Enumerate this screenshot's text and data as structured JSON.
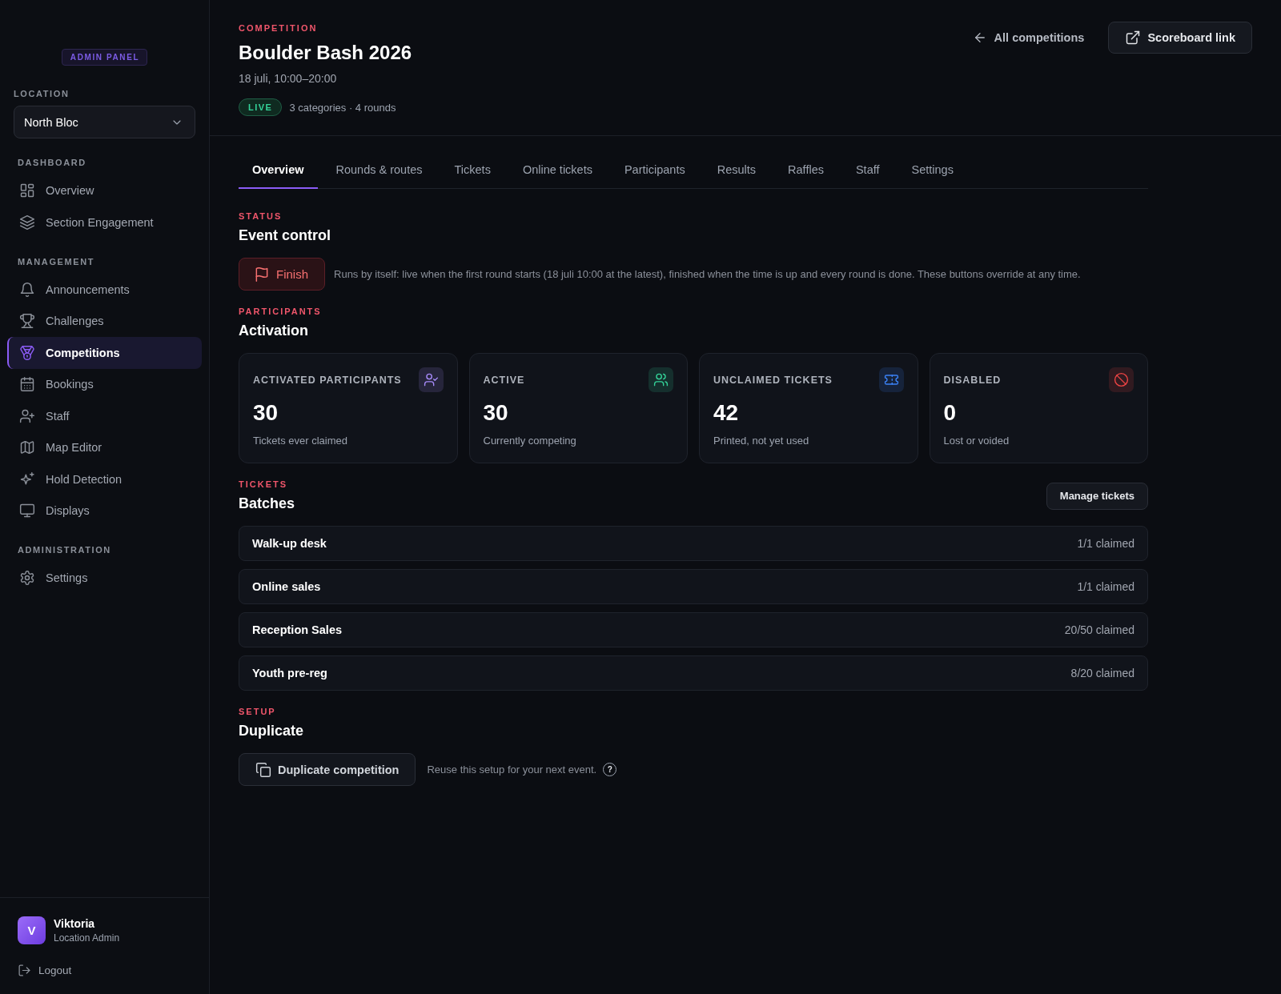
{
  "sidebar": {
    "badge": "ADMIN PANEL",
    "location": {
      "label": "LOCATION",
      "value": "North Bloc"
    },
    "sections": [
      {
        "heading": "DASHBOARD",
        "items": [
          {
            "label": "Overview",
            "selected": false
          },
          {
            "label": "Section Engagement",
            "selected": false
          }
        ]
      },
      {
        "heading": "MANAGEMENT",
        "items": [
          {
            "label": "Announcements",
            "selected": false
          },
          {
            "label": "Challenges",
            "selected": false
          },
          {
            "label": "Competitions",
            "selected": true
          },
          {
            "label": "Bookings",
            "selected": false
          },
          {
            "label": "Staff",
            "selected": false
          },
          {
            "label": "Map Editor",
            "selected": false
          },
          {
            "label": "Hold Detection",
            "selected": false
          },
          {
            "label": "Displays",
            "selected": false
          }
        ]
      },
      {
        "heading": "ADMINISTRATION",
        "items": [
          {
            "label": "Settings",
            "selected": false
          }
        ]
      }
    ],
    "user": {
      "initial": "V",
      "name": "Viktoria",
      "role": "Location Admin"
    },
    "logout": "Logout"
  },
  "header": {
    "eyebrow": "COMPETITION",
    "title": "Boulder Bash 2026",
    "date": "18 juli, 10:00–20:00",
    "status": "LIVE",
    "meta": "3 categories · 4 rounds",
    "back_link": "All competitions",
    "scoreboard_button": "Scoreboard link"
  },
  "tabs": [
    {
      "label": "Overview",
      "selected": true
    },
    {
      "label": "Rounds & routes",
      "selected": false
    },
    {
      "label": "Tickets",
      "selected": false
    },
    {
      "label": "Online tickets",
      "selected": false
    },
    {
      "label": "Participants",
      "selected": false
    },
    {
      "label": "Results",
      "selected": false
    },
    {
      "label": "Raffles",
      "selected": false
    },
    {
      "label": "Staff",
      "selected": false
    },
    {
      "label": "Settings",
      "selected": false
    }
  ],
  "status_section": {
    "eyebrow": "STATUS",
    "title": "Event control",
    "button": "Finish",
    "note": "Runs by itself: live when the first round starts (18 juli 10:00 at the latest), finished when the time is up and every round is done. These buttons override at any time."
  },
  "participants_section": {
    "eyebrow": "PARTICIPANTS",
    "title": "Activation",
    "stats": [
      {
        "label": "ACTIVATED PARTICIPANTS",
        "value": "30",
        "caption": "Tickets ever claimed",
        "color": "#a78bfa"
      },
      {
        "label": "ACTIVE",
        "value": "30",
        "caption": "Currently competing",
        "color": "#34d399"
      },
      {
        "label": "UNCLAIMED TICKETS",
        "value": "42",
        "caption": "Printed, not yet used",
        "color": "#3b82f6"
      },
      {
        "label": "DISABLED",
        "value": "0",
        "caption": "Lost or voided",
        "color": "#ef4444"
      }
    ]
  },
  "tickets_section": {
    "eyebrow": "TICKETS",
    "title": "Batches",
    "button": "Manage tickets",
    "batches": [
      {
        "name": "Walk-up desk",
        "claimed": "1/1 claimed"
      },
      {
        "name": "Online sales",
        "claimed": "1/1 claimed"
      },
      {
        "name": "Reception Sales",
        "claimed": "20/50 claimed"
      },
      {
        "name": "Youth pre-reg",
        "claimed": "8/20 claimed"
      }
    ]
  },
  "setup_section": {
    "eyebrow": "SETUP",
    "title": "Duplicate",
    "button": "Duplicate competition",
    "note": "Reuse this setup for your next event.",
    "help": "?"
  }
}
